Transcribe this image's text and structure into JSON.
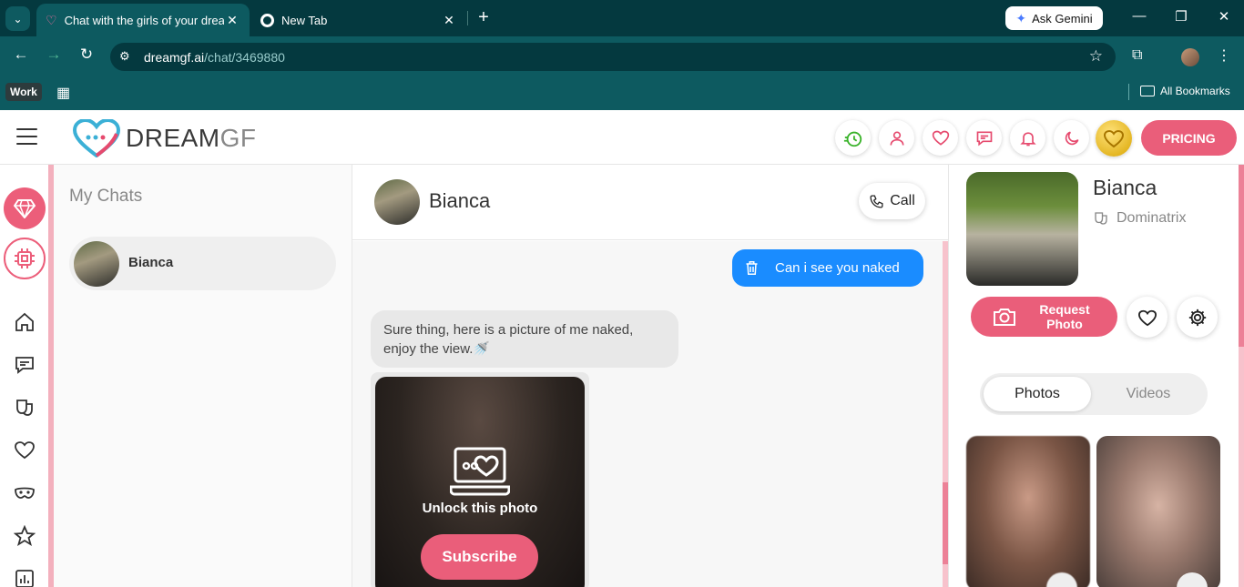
{
  "browser": {
    "tabs": [
      {
        "title": "Chat with the girls of your dreams",
        "active": true
      },
      {
        "title": "New Tab",
        "active": false
      }
    ],
    "gemini_label": "Ask Gemini",
    "url_host": "dreamgf.ai",
    "url_path": "/chat/3469880",
    "bookmarks": {
      "work_label": "Work",
      "all_bookmarks_label": "All Bookmarks"
    }
  },
  "header": {
    "logo_main": "DREAM",
    "logo_accent": "GF",
    "pricing_label": "PRICING"
  },
  "chats": {
    "title": "My Chats",
    "items": [
      {
        "name": "Bianca"
      }
    ]
  },
  "chat": {
    "contact_name": "Bianca",
    "call_label": "Call",
    "messages": {
      "outgoing": "Can i see you naked",
      "incoming": "Sure thing, here is a picture of me naked, enjoy the view.🚿"
    },
    "locked_photo": {
      "label": "Unlock this photo",
      "subscribe_label": "Subscribe"
    }
  },
  "profile": {
    "name": "Bianca",
    "role": "Dominatrix",
    "request_photo_label": "Request Photo",
    "media_tabs": [
      {
        "label": "Photos",
        "active": true
      },
      {
        "label": "Videos",
        "active": false
      }
    ]
  },
  "colors": {
    "brand_pink": "#ea5e7a",
    "outgoing_bubble": "#1a8cff",
    "chrome_dark": "#04393f",
    "chrome_mid": "#0d5a60"
  }
}
